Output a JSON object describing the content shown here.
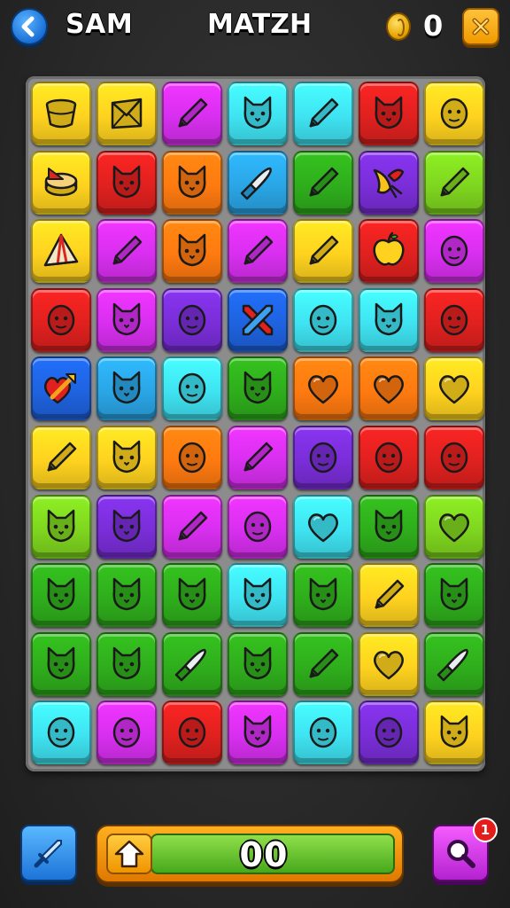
{
  "header": {
    "player_name": "SAM",
    "title": "MATZH",
    "coin_count": "0"
  },
  "footer": {
    "score": "00",
    "notification_count": "1"
  },
  "colors": {
    "yellow": "#ffd21f",
    "cyan": "#3fe3f2",
    "magenta": "#d82ff0",
    "red": "#e0211f",
    "orange": "#ff7a10",
    "blue": "#1e63e0",
    "purple": "#7a2ed8",
    "green": "#2fae1c",
    "lime": "#7fd61f",
    "skyblue": "#2aa6e6"
  },
  "board": {
    "rows": [
      [
        {
          "color": "yellow",
          "icon": "bucket"
        },
        {
          "color": "yellow",
          "icon": "envelope"
        },
        {
          "color": "magenta",
          "icon": "pen"
        },
        {
          "color": "cyan",
          "icon": "cat"
        },
        {
          "color": "cyan",
          "icon": "pen"
        },
        {
          "color": "red",
          "icon": "cat"
        },
        {
          "color": "yellow",
          "icon": "face"
        }
      ],
      [
        {
          "color": "yellow",
          "icon": "cake"
        },
        {
          "color": "red",
          "icon": "cat"
        },
        {
          "color": "orange",
          "icon": "cat"
        },
        {
          "color": "skyblue",
          "icon": "knife"
        },
        {
          "color": "green",
          "icon": "pen"
        },
        {
          "color": "purple",
          "icon": "bird"
        },
        {
          "color": "lime",
          "icon": "pen"
        }
      ],
      [
        {
          "color": "yellow",
          "icon": "tent"
        },
        {
          "color": "magenta",
          "icon": "pen"
        },
        {
          "color": "orange",
          "icon": "cat"
        },
        {
          "color": "magenta",
          "icon": "pen"
        },
        {
          "color": "yellow",
          "icon": "pen"
        },
        {
          "color": "red",
          "icon": "apple"
        },
        {
          "color": "magenta",
          "icon": "face"
        }
      ],
      [
        {
          "color": "red",
          "icon": "face"
        },
        {
          "color": "magenta",
          "icon": "cat"
        },
        {
          "color": "purple",
          "icon": "face"
        },
        {
          "color": "blue",
          "icon": "crossed-pens"
        },
        {
          "color": "cyan",
          "icon": "face"
        },
        {
          "color": "cyan",
          "icon": "cat"
        },
        {
          "color": "red",
          "icon": "face"
        }
      ],
      [
        {
          "color": "blue",
          "icon": "heart-arrow"
        },
        {
          "color": "skyblue",
          "icon": "cat"
        },
        {
          "color": "cyan",
          "icon": "face"
        },
        {
          "color": "green",
          "icon": "cat"
        },
        {
          "color": "orange",
          "icon": "heart"
        },
        {
          "color": "orange",
          "icon": "heart"
        },
        {
          "color": "yellow",
          "icon": "heart"
        }
      ],
      [
        {
          "color": "yellow",
          "icon": "pen"
        },
        {
          "color": "yellow",
          "icon": "cat"
        },
        {
          "color": "orange",
          "icon": "face"
        },
        {
          "color": "magenta",
          "icon": "pen"
        },
        {
          "color": "purple",
          "icon": "face"
        },
        {
          "color": "red",
          "icon": "face"
        },
        {
          "color": "red",
          "icon": "face"
        }
      ],
      [
        {
          "color": "lime",
          "icon": "cat"
        },
        {
          "color": "purple",
          "icon": "cat"
        },
        {
          "color": "magenta",
          "icon": "pen"
        },
        {
          "color": "magenta",
          "icon": "face"
        },
        {
          "color": "cyan",
          "icon": "heart"
        },
        {
          "color": "green",
          "icon": "cat"
        },
        {
          "color": "lime",
          "icon": "heart"
        }
      ],
      [
        {
          "color": "green",
          "icon": "cat"
        },
        {
          "color": "green",
          "icon": "cat"
        },
        {
          "color": "green",
          "icon": "cat"
        },
        {
          "color": "cyan",
          "icon": "cat"
        },
        {
          "color": "green",
          "icon": "cat"
        },
        {
          "color": "yellow",
          "icon": "pen"
        },
        {
          "color": "green",
          "icon": "cat"
        }
      ],
      [
        {
          "color": "green",
          "icon": "cat"
        },
        {
          "color": "green",
          "icon": "cat"
        },
        {
          "color": "green",
          "icon": "knife"
        },
        {
          "color": "green",
          "icon": "cat"
        },
        {
          "color": "green",
          "icon": "pen"
        },
        {
          "color": "yellow",
          "icon": "heart"
        },
        {
          "color": "green",
          "icon": "knife"
        }
      ],
      [
        {
          "color": "cyan",
          "icon": "face"
        },
        {
          "color": "magenta",
          "icon": "face"
        },
        {
          "color": "red",
          "icon": "face"
        },
        {
          "color": "magenta",
          "icon": "cat"
        },
        {
          "color": "cyan",
          "icon": "face"
        },
        {
          "color": "purple",
          "icon": "face"
        },
        {
          "color": "yellow",
          "icon": "cat"
        }
      ]
    ]
  }
}
